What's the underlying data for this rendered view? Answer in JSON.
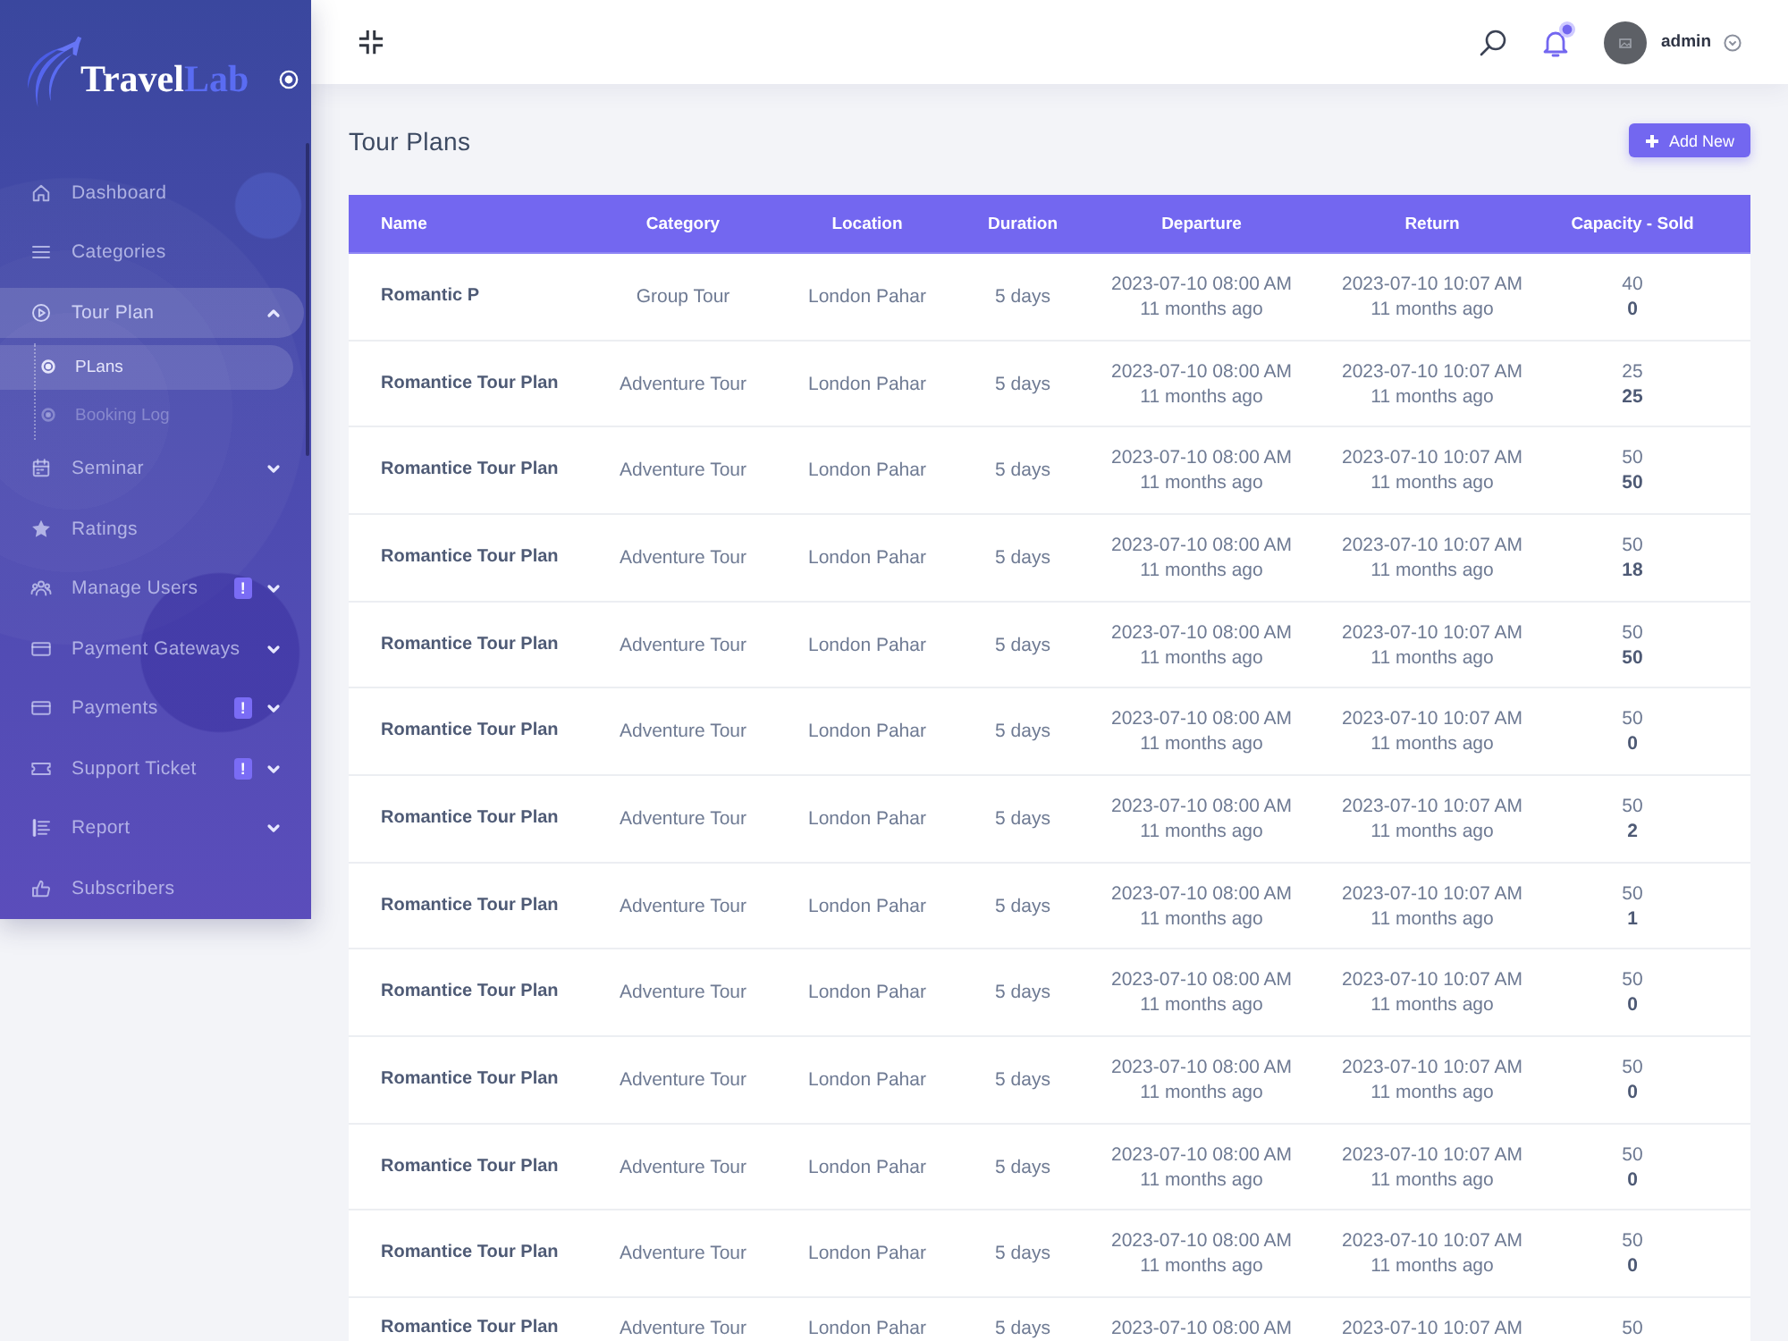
{
  "sidebar": {
    "logo": {
      "primary": "Travel",
      "accent": "Lab"
    },
    "items": [
      {
        "label": "Dashboard",
        "selected": false
      },
      {
        "label": "Categories",
        "selected": false
      },
      {
        "label": "Tour Plan",
        "selected": true,
        "expanded": true,
        "children": [
          {
            "label": "PLans",
            "selected": true
          },
          {
            "label": "Booking Log",
            "selected": false
          }
        ]
      },
      {
        "label": "Seminar",
        "selected": false,
        "expanded": false
      },
      {
        "label": "Ratings",
        "selected": false
      },
      {
        "label": "Manage Users",
        "selected": false,
        "badge": "!",
        "expanded": false
      },
      {
        "label": "Payment Gateways",
        "selected": false,
        "expanded": false
      },
      {
        "label": "Payments",
        "selected": false,
        "badge": "!",
        "expanded": false
      },
      {
        "label": "Support Ticket",
        "selected": false,
        "badge": "!",
        "expanded": false
      },
      {
        "label": "Report",
        "selected": false,
        "expanded": false
      },
      {
        "label": "Subscribers",
        "selected": false
      }
    ]
  },
  "topbar": {
    "notifications": {
      "unread": true
    },
    "user": {
      "name": "admin"
    }
  },
  "page": {
    "title": "Tour Plans",
    "add_button": "Add New"
  },
  "table": {
    "columns": [
      "Name",
      "Category",
      "Location",
      "Duration",
      "Departure",
      "Return",
      "Capacity - Sold"
    ],
    "rows": [
      {
        "name": "Romantic P",
        "category": "Group Tour",
        "location": "London Pahar",
        "duration": "5 days",
        "departure": "2023-07-10 08:00 AM",
        "departure_ago": "11 months ago",
        "return": "2023-07-10 10:07 AM",
        "return_ago": "11 months ago",
        "capacity": "40",
        "sold": "0"
      },
      {
        "name": "Romantice Tour Plan",
        "category": "Adventure Tour",
        "location": "London Pahar",
        "duration": "5 days",
        "departure": "2023-07-10 08:00 AM",
        "departure_ago": "11 months ago",
        "return": "2023-07-10 10:07 AM",
        "return_ago": "11 months ago",
        "capacity": "25",
        "sold": "25"
      },
      {
        "name": "Romantice Tour Plan",
        "category": "Adventure Tour",
        "location": "London Pahar",
        "duration": "5 days",
        "departure": "2023-07-10 08:00 AM",
        "departure_ago": "11 months ago",
        "return": "2023-07-10 10:07 AM",
        "return_ago": "11 months ago",
        "capacity": "50",
        "sold": "50"
      },
      {
        "name": "Romantice Tour Plan",
        "category": "Adventure Tour",
        "location": "London Pahar",
        "duration": "5 days",
        "departure": "2023-07-10 08:00 AM",
        "departure_ago": "11 months ago",
        "return": "2023-07-10 10:07 AM",
        "return_ago": "11 months ago",
        "capacity": "50",
        "sold": "18"
      },
      {
        "name": "Romantice Tour Plan",
        "category": "Adventure Tour",
        "location": "London Pahar",
        "duration": "5 days",
        "departure": "2023-07-10 08:00 AM",
        "departure_ago": "11 months ago",
        "return": "2023-07-10 10:07 AM",
        "return_ago": "11 months ago",
        "capacity": "50",
        "sold": "50"
      },
      {
        "name": "Romantice Tour Plan",
        "category": "Adventure Tour",
        "location": "London Pahar",
        "duration": "5 days",
        "departure": "2023-07-10 08:00 AM",
        "departure_ago": "11 months ago",
        "return": "2023-07-10 10:07 AM",
        "return_ago": "11 months ago",
        "capacity": "50",
        "sold": "0"
      },
      {
        "name": "Romantice Tour Plan",
        "category": "Adventure Tour",
        "location": "London Pahar",
        "duration": "5 days",
        "departure": "2023-07-10 08:00 AM",
        "departure_ago": "11 months ago",
        "return": "2023-07-10 10:07 AM",
        "return_ago": "11 months ago",
        "capacity": "50",
        "sold": "2"
      },
      {
        "name": "Romantice Tour Plan",
        "category": "Adventure Tour",
        "location": "London Pahar",
        "duration": "5 days",
        "departure": "2023-07-10 08:00 AM",
        "departure_ago": "11 months ago",
        "return": "2023-07-10 10:07 AM",
        "return_ago": "11 months ago",
        "capacity": "50",
        "sold": "1"
      },
      {
        "name": "Romantice Tour Plan",
        "category": "Adventure Tour",
        "location": "London Pahar",
        "duration": "5 days",
        "departure": "2023-07-10 08:00 AM",
        "departure_ago": "11 months ago",
        "return": "2023-07-10 10:07 AM",
        "return_ago": "11 months ago",
        "capacity": "50",
        "sold": "0"
      },
      {
        "name": "Romantice Tour Plan",
        "category": "Adventure Tour",
        "location": "London Pahar",
        "duration": "5 days",
        "departure": "2023-07-10 08:00 AM",
        "departure_ago": "11 months ago",
        "return": "2023-07-10 10:07 AM",
        "return_ago": "11 months ago",
        "capacity": "50",
        "sold": "0"
      },
      {
        "name": "Romantice Tour Plan",
        "category": "Adventure Tour",
        "location": "London Pahar",
        "duration": "5 days",
        "departure": "2023-07-10 08:00 AM",
        "departure_ago": "11 months ago",
        "return": "2023-07-10 10:07 AM",
        "return_ago": "11 months ago",
        "capacity": "50",
        "sold": "0"
      },
      {
        "name": "Romantice Tour Plan",
        "category": "Adventure Tour",
        "location": "London Pahar",
        "duration": "5 days",
        "departure": "2023-07-10 08:00 AM",
        "departure_ago": "11 months ago",
        "return": "2023-07-10 10:07 AM",
        "return_ago": "11 months ago",
        "capacity": "50",
        "sold": "0"
      },
      {
        "name": "Romantice Tour Plan",
        "category": "Adventure Tour",
        "location": "London Pahar",
        "duration": "5 days",
        "departure": "2023-07-10 08:00 AM",
        "return": "2023-07-10 10:07 AM",
        "capacity": "50"
      }
    ]
  }
}
